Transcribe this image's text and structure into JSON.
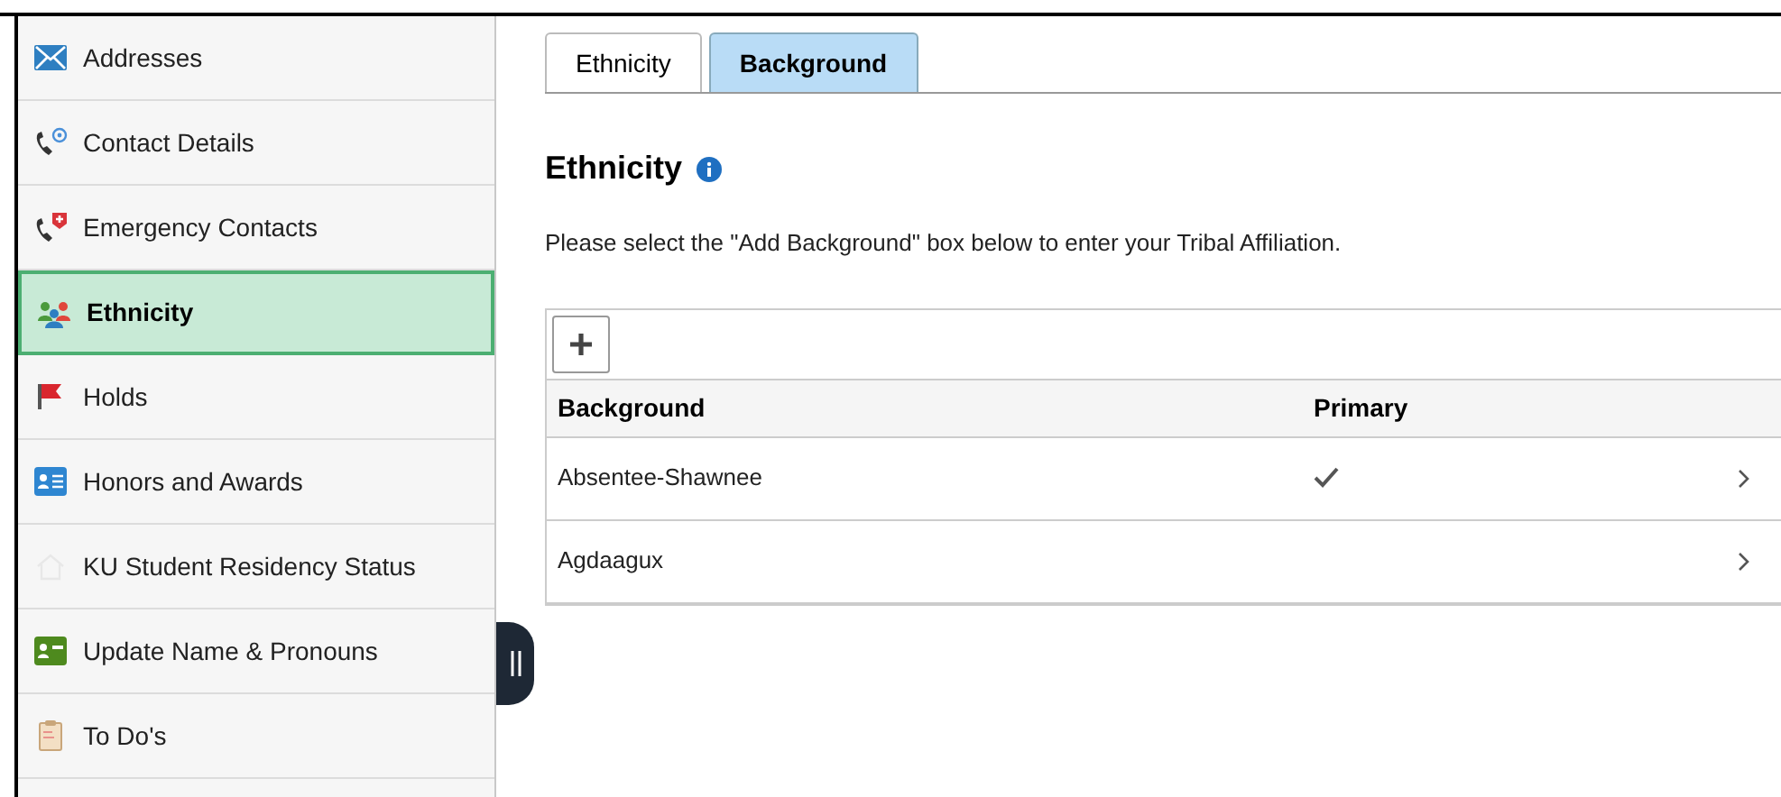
{
  "sidebar": {
    "items": [
      {
        "label": "Addresses",
        "kind": "mail",
        "selected": false
      },
      {
        "label": "Contact Details",
        "kind": "phone-at",
        "selected": false
      },
      {
        "label": "Emergency Contacts",
        "kind": "phone-plus",
        "selected": false
      },
      {
        "label": "Ethnicity",
        "kind": "people",
        "selected": true
      },
      {
        "label": "Holds",
        "kind": "flag",
        "selected": false
      },
      {
        "label": "Honors and Awards",
        "kind": "card",
        "selected": false
      },
      {
        "label": "KU Student Residency Status",
        "kind": "home",
        "selected": false
      },
      {
        "label": "Update Name & Pronouns",
        "kind": "card-green",
        "selected": false
      },
      {
        "label": "To Do's",
        "kind": "clipboard",
        "selected": false
      }
    ]
  },
  "tabs": [
    {
      "label": "Ethnicity",
      "selected": false
    },
    {
      "label": "Background",
      "selected": true
    }
  ],
  "heading": "Ethnicity",
  "instructions": "Please select the \"Add Background\" box below to enter your Tribal Affiliation.",
  "table": {
    "columns": [
      "Background",
      "Primary"
    ],
    "rows": [
      {
        "background": "Absentee-Shawnee",
        "primary": true
      },
      {
        "background": "Agdaagux",
        "primary": false
      }
    ]
  }
}
